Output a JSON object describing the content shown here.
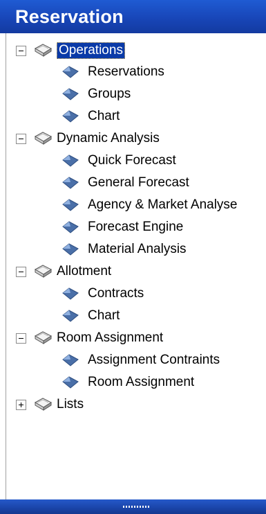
{
  "header": {
    "title": "Reservation"
  },
  "tree": {
    "operations": {
      "label": "Operations",
      "expanded": true,
      "selected": true,
      "children": [
        "Reservations",
        "Groups",
        "Chart"
      ]
    },
    "dynamic_analysis": {
      "label": "Dynamic Analysis",
      "expanded": true,
      "children": [
        "Quick Forecast",
        "General Forecast",
        "Agency & Market Analyse",
        "Forecast Engine",
        "Material Analysis"
      ]
    },
    "allotment": {
      "label": "Allotment",
      "expanded": true,
      "children": [
        "Contracts",
        "Chart"
      ]
    },
    "room_assignment": {
      "label": "Room Assignment",
      "expanded": true,
      "children": [
        "Assignment Contraints",
        "Room Assignment"
      ]
    },
    "lists": {
      "label": "Lists",
      "expanded": false
    }
  },
  "colors": {
    "header_blue": "#1846b8",
    "selection_blue": "#0a3aa8",
    "node_diamond": "#4a6fa8"
  },
  "icons": {
    "group": "folder-book-icon",
    "item": "diamond-node-icon",
    "collapse": "minus-toggle-icon",
    "expand": "plus-toggle-icon"
  }
}
